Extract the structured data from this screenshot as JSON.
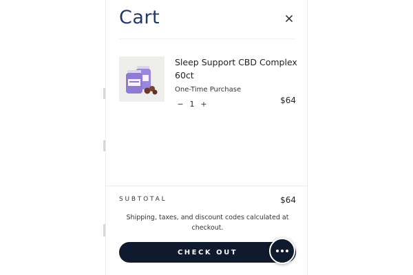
{
  "cart": {
    "title": "Cart",
    "close_icon": "close-icon"
  },
  "item": {
    "name": "Sleep Support CBD Complex 60ct",
    "purchase_type": "One-Time Purchase",
    "quantity": "1",
    "decrease_symbol": "−",
    "increase_symbol": "+",
    "price": "$64",
    "image_icon": "product-bottle-image"
  },
  "summary": {
    "subtotal_label": "SUBTOTAL",
    "subtotal_value": "$64",
    "shipping_note": "Shipping, taxes, and discount codes calculated at checkout."
  },
  "checkout": {
    "label": "CHECK OUT"
  },
  "chat": {
    "icon": "chat-bubble-icon"
  },
  "colors": {
    "title": "#1f3a68",
    "button": "#0f1a2e",
    "product_purple": "#8f7ad6",
    "gummy_brown": "#6b3a2e"
  }
}
